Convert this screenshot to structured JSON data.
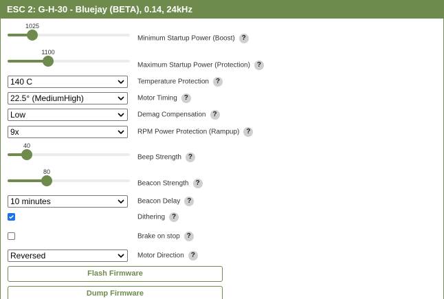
{
  "header": {
    "title": "ESC 2: G-H-30 - Bluejay (BETA), 0.14, 24kHz"
  },
  "help_glyph": "?",
  "settings": {
    "min_startup_power": {
      "label": "Minimum Startup Power (Boost)",
      "value": "1025",
      "fraction": 0.2
    },
    "max_startup_power": {
      "label": "Maximum Startup Power (Protection)",
      "value": "1100",
      "fraction": 0.33
    },
    "temperature_protection": {
      "label": "Temperature Protection",
      "value": "140 C"
    },
    "motor_timing": {
      "label": "Motor Timing",
      "value": "22.5° (MediumHigh)"
    },
    "demag_compensation": {
      "label": "Demag Compensation",
      "value": "Low"
    },
    "rpm_power_protection": {
      "label": "RPM Power Protection (Rampup)",
      "value": "9x"
    },
    "beep_strength": {
      "label": "Beep Strength",
      "value": "40",
      "fraction": 0.16
    },
    "beacon_strength": {
      "label": "Beacon Strength",
      "value": "80",
      "fraction": 0.32
    },
    "beacon_delay": {
      "label": "Beacon Delay",
      "value": "10 minutes"
    },
    "dithering": {
      "label": "Dithering",
      "checked": true
    },
    "brake_on_stop": {
      "label": "Brake on stop",
      "checked": false
    },
    "motor_direction": {
      "label": "Motor Direction",
      "value": "Reversed"
    }
  },
  "buttons": {
    "flash": "Flash Firmware",
    "dump": "Dump Firmware"
  },
  "colors": {
    "accent": "#6e8a4c",
    "checkbox_checked": "#1a73e8"
  }
}
